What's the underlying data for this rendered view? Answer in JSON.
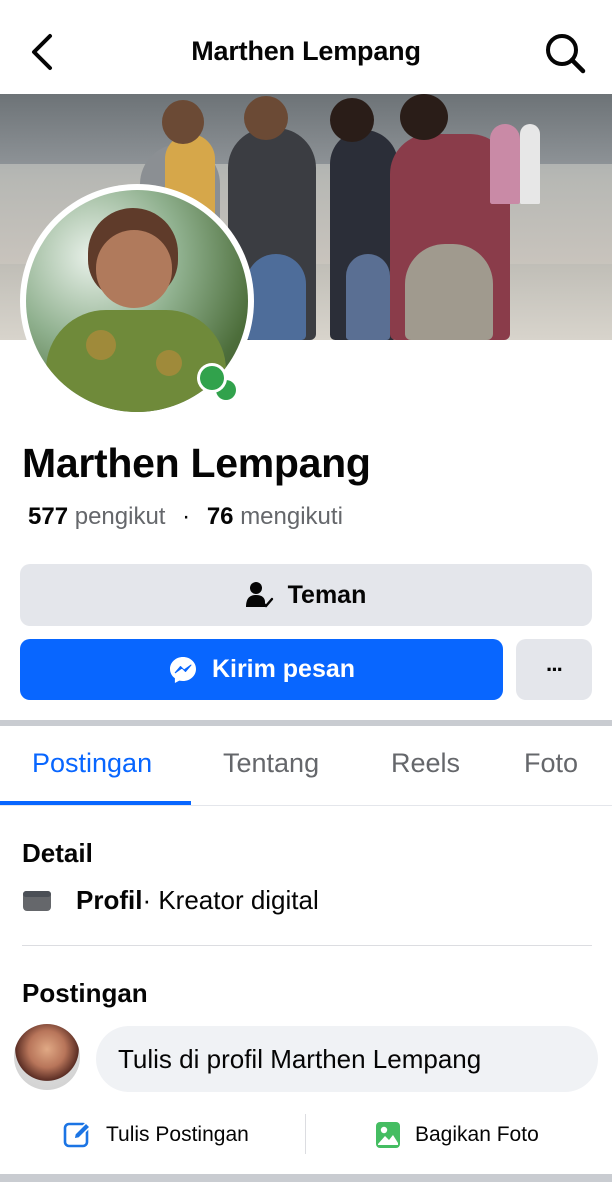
{
  "header": {
    "title": "Marthen Lempang",
    "back_icon": "back-arrow-icon",
    "search_icon": "search-icon"
  },
  "profile": {
    "name": "Marthen Lempang",
    "followers_count": "577",
    "followers_label": "pengikut",
    "separator": "·",
    "following_count": "76",
    "following_label": "mengikuti",
    "online": true
  },
  "actions": {
    "friend_label": "Teman",
    "message_label": "Kirim pesan",
    "more_label": "···"
  },
  "tabs": [
    {
      "label": "Postingan",
      "active": true
    },
    {
      "label": "Tentang",
      "active": false
    },
    {
      "label": "Reels",
      "active": false
    },
    {
      "label": "Foto",
      "active": false
    }
  ],
  "details": {
    "title": "Detail",
    "row_bold": "Profil",
    "row_rest": " · Kreator digital"
  },
  "posts": {
    "title": "Postingan",
    "composer_placeholder": "Tulis di profil Marthen Lempang",
    "write_post_label": "Tulis Postingan",
    "share_photo_label": "Bagikan Foto"
  },
  "colors": {
    "accent": "#0866ff",
    "online": "#31a24c",
    "button_gray": "#e4e6eb"
  }
}
